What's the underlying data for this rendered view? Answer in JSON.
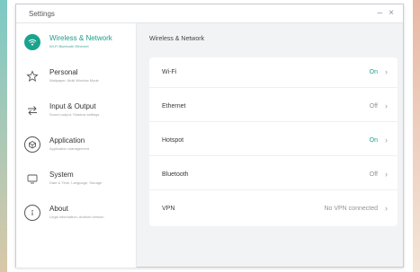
{
  "window": {
    "title": "Settings",
    "minimize": "–",
    "close": "×"
  },
  "colors": {
    "accent": "#1aa38e",
    "on_text": "#1aa38e",
    "off_text": "#8e949a"
  },
  "sidebar": {
    "items": [
      {
        "label": "Wireless & Network",
        "sub": "Wi-Fi Bluetooth Ethernet",
        "icon": "wifi-icon",
        "active": true
      },
      {
        "label": "Personal",
        "sub": "Wallpaper, Multi Window Mode",
        "icon": "star-icon",
        "active": false
      },
      {
        "label": "Input & Output",
        "sub": "Sound output, Shadow settings",
        "icon": "arrows-icon",
        "active": false
      },
      {
        "label": "Application",
        "sub": "Application management",
        "icon": "cube-icon",
        "active": false
      },
      {
        "label": "System",
        "sub": "Date & Time, Language, Storage",
        "icon": "monitor-icon",
        "active": false
      },
      {
        "label": "About",
        "sub": "Legal information, Android version",
        "icon": "info-icon",
        "active": false
      }
    ]
  },
  "main": {
    "title": "Wireless & Network",
    "rows": [
      {
        "label": "Wi-Fi",
        "value": "On",
        "state": "on"
      },
      {
        "label": "Ethernet",
        "value": "Off",
        "state": "off"
      },
      {
        "label": "Hotspot",
        "value": "On",
        "state": "on"
      },
      {
        "label": "Bluetooth",
        "value": "Off",
        "state": "off"
      },
      {
        "label": "VPN",
        "value": "No VPN connected",
        "state": "off"
      }
    ],
    "chevron": "›"
  }
}
